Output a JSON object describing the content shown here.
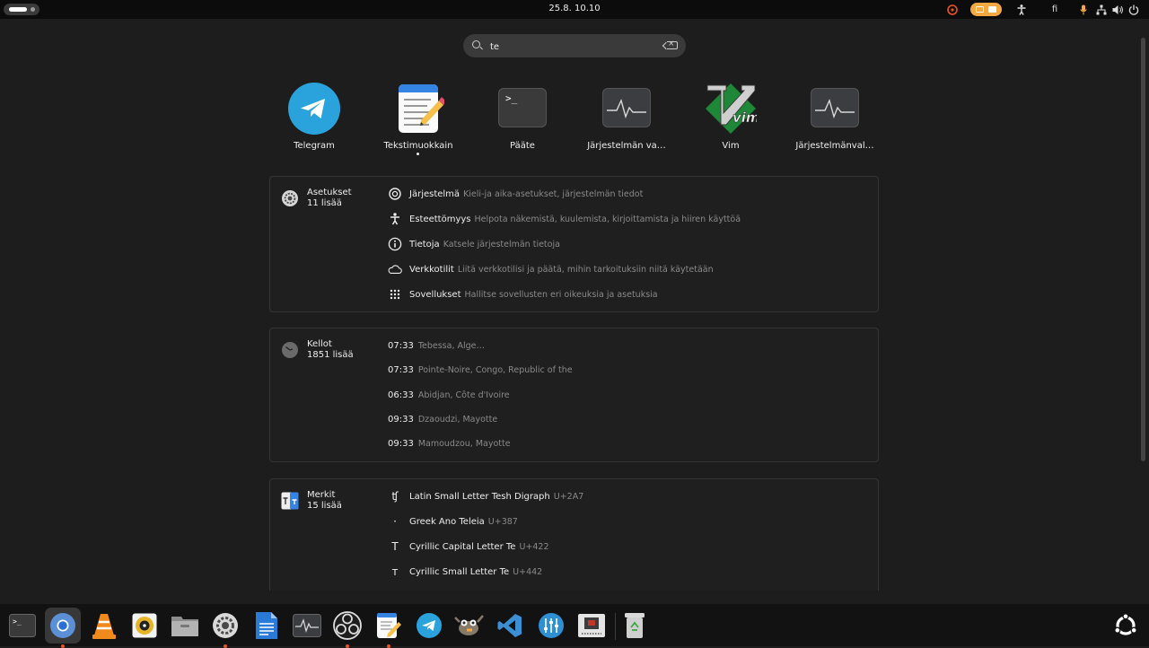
{
  "topbar": {
    "clock": "25.8.  10.10",
    "language": "fi"
  },
  "search": {
    "value": "te"
  },
  "apps": [
    {
      "name": "Telegram",
      "icon": "telegram-icon"
    },
    {
      "name": "Tekstimuokkain",
      "icon": "text-editor-icon",
      "running": true
    },
    {
      "name": "Pääte",
      "icon": "terminal-icon"
    },
    {
      "name": "Järjestelmän va…",
      "icon": "system-monitor-icon"
    },
    {
      "name": "Vim",
      "icon": "vim-icon"
    },
    {
      "name": "Järjestelmänval…",
      "icon": "system-monitor-icon"
    }
  ],
  "settings": {
    "title": "Asetukset",
    "more": "11 lisää",
    "items": [
      {
        "title": "Järjestelmä",
        "desc": "Kieli-ja aika-asetukset, järjestelmän tiedot",
        "icon": "gear-icon"
      },
      {
        "title": "Esteettömyys",
        "desc": "Helpota näkemistä, kuulemista, kirjoittamista ja hiiren käyttöä",
        "icon": "accessibility-icon"
      },
      {
        "title": "Tietoja",
        "desc": "Katsele järjestelmän tietoja",
        "icon": "info-icon"
      },
      {
        "title": "Verkkotilit",
        "desc": "Liitä verkkotilisi ja päätä, mihin tarkoituksiin niitä käytetään",
        "icon": "cloud-icon"
      },
      {
        "title": "Sovellukset",
        "desc": "Hallitse sovellusten eri oikeuksia ja asetuksia",
        "icon": "apps-grid-icon"
      }
    ]
  },
  "clocks": {
    "title": "Kellot",
    "more": "1851 lisää",
    "items": [
      {
        "time": "07:33",
        "place": "Tebessa, Alge…"
      },
      {
        "time": "07:33",
        "place": "Pointe-Noire, Congo, Republic of the"
      },
      {
        "time": "06:33",
        "place": "Abidjan, Côte d'Ivoire"
      },
      {
        "time": "09:33",
        "place": "Dzaoudzi, Mayotte"
      },
      {
        "time": "09:33",
        "place": "Mamoudzou, Mayotte"
      }
    ]
  },
  "characters": {
    "title": "Merkit",
    "more": "15 lisää",
    "items": [
      {
        "glyph": "ʧ",
        "name": "Latin Small Letter Tesh Digraph",
        "code": "U+2A7"
      },
      {
        "glyph": "·",
        "name": "Greek Ano Teleia",
        "code": "U+387"
      },
      {
        "glyph": "Т",
        "name": "Cyrillic Capital Letter Te",
        "code": "U+422"
      },
      {
        "glyph": "т",
        "name": "Cyrillic Small Letter Te",
        "code": "U+442"
      }
    ]
  },
  "colors": {
    "accent": "#e95420",
    "telegram": "#2aa3dc",
    "tray_pill": "#f5a742"
  }
}
